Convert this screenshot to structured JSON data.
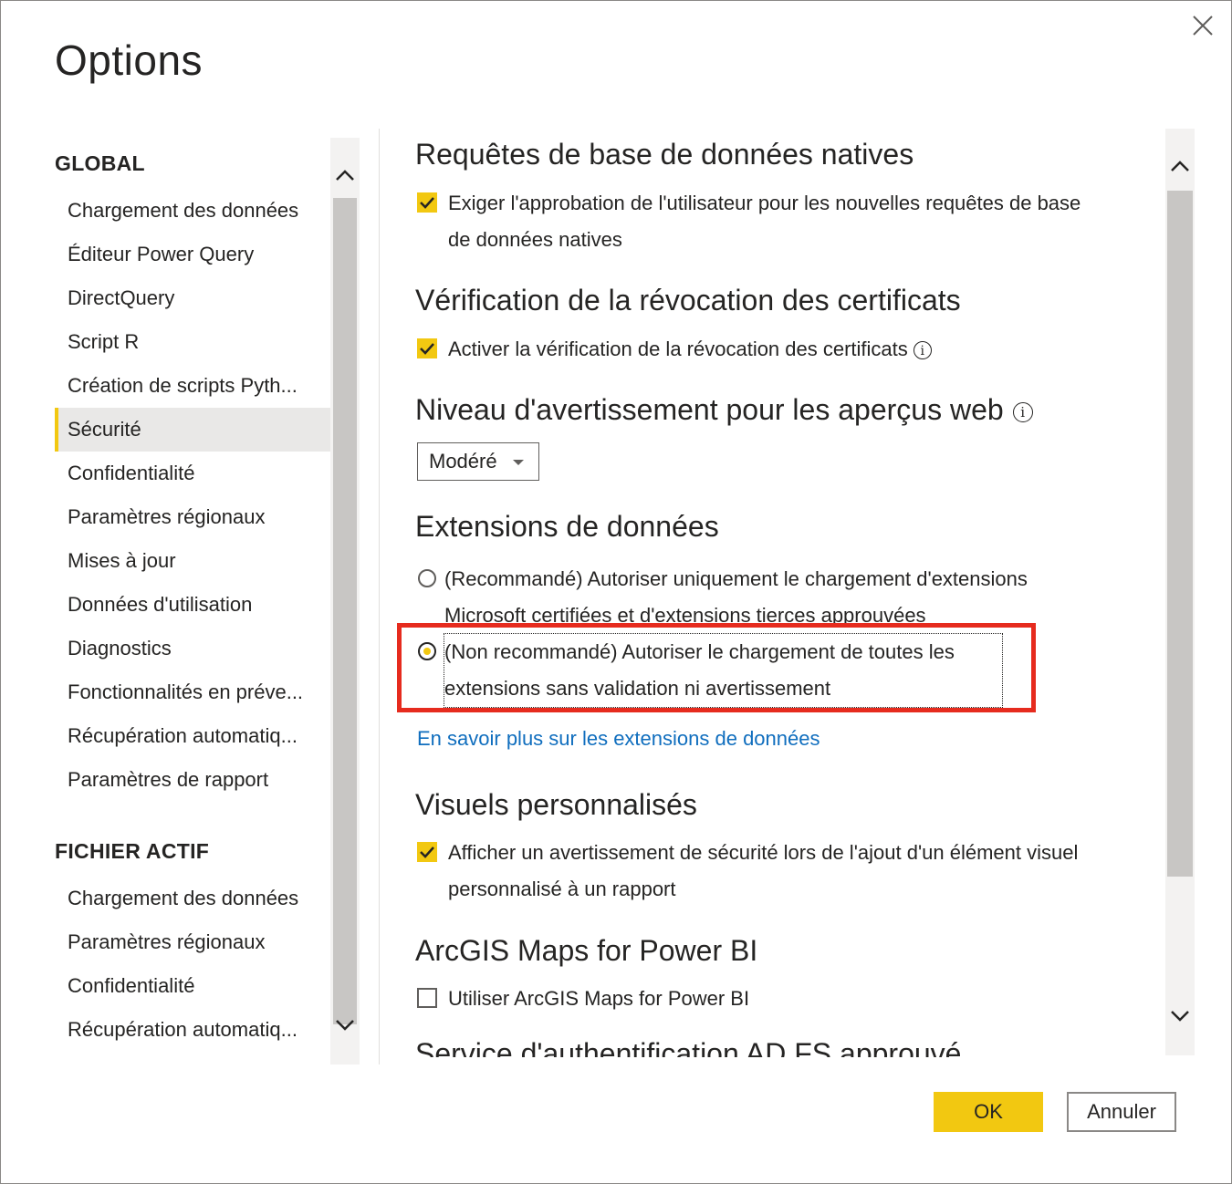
{
  "dialog": {
    "title": "Options",
    "close_label": "×"
  },
  "nav": {
    "global_heading": "GLOBAL",
    "global_items": [
      "Chargement des données",
      "Éditeur Power Query",
      "DirectQuery",
      "Script R",
      "Création de scripts Pyth...",
      "Sécurité",
      "Confidentialité",
      "Paramètres régionaux",
      "Mises à jour",
      "Données d'utilisation",
      "Diagnostics",
      "Fonctionnalités en préve...",
      "Récupération automatiq...",
      "Paramètres de rapport"
    ],
    "active_item": "Sécurité",
    "file_heading": "FICHIER ACTIF",
    "file_items": [
      "Chargement des données",
      "Paramètres régionaux",
      "Confidentialité",
      "Récupération automatiq..."
    ]
  },
  "content": {
    "native_queries": {
      "heading": "Requêtes de base de données natives",
      "option": "Exiger l'approbation de l'utilisateur pour les nouvelles requêtes de base de données natives",
      "checked": true
    },
    "revocation": {
      "heading": "Vérification de la révocation des certificats",
      "option": "Activer la vérification de la révocation des certificats",
      "checked": true,
      "info": "i"
    },
    "web_preview": {
      "heading": "Niveau d'avertissement pour les aperçus web",
      "info": "i",
      "dropdown_value": "Modéré"
    },
    "data_extensions": {
      "heading": "Extensions de données",
      "option_recommended": "(Recommandé) Autoriser uniquement le chargement d'extensions Microsoft certifiées et d'extensions tierces approuvées",
      "option_not_recommended": "(Non recommandé) Autoriser le chargement de toutes les extensions sans validation ni avertissement",
      "selected": "not_recommended",
      "learn_more": "En savoir plus sur les extensions de données"
    },
    "custom_visuals": {
      "heading": "Visuels personnalisés",
      "option": "Afficher un avertissement de sécurité lors de l'ajout d'un élément visuel personnalisé à un rapport",
      "checked": true
    },
    "arcgis": {
      "heading": "ArcGIS Maps for Power BI",
      "option": "Utiliser ArcGIS Maps for Power BI",
      "checked": false
    },
    "adfs": {
      "heading": "Service d'authentification AD FS approuvé"
    }
  },
  "buttons": {
    "ok": "OK",
    "cancel": "Annuler"
  },
  "colors": {
    "accent": "#f2c811",
    "highlight_box": "#e62b1e",
    "link": "#106ebe"
  }
}
